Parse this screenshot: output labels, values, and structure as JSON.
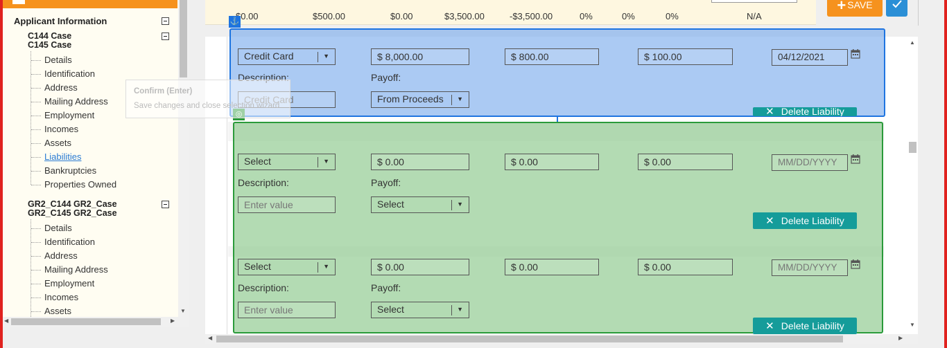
{
  "tree": {
    "section_title": "Applicant Information",
    "applicant1": {
      "line1": "C144 Case",
      "line2": "C145 Case",
      "items": [
        "Details",
        "Identification",
        "Address",
        "Mailing Address",
        "Employment",
        "Incomes",
        "Assets",
        "Liabilities",
        "Bankruptcies",
        "Properties Owned"
      ],
      "active": "Liabilities"
    },
    "applicant2": {
      "line1": "GR2_C144 GR2_Case",
      "line2": "GR2_C145 GR2_Case",
      "items": [
        "Details",
        "Identification",
        "Address",
        "Mailing Address",
        "Employment",
        "Incomes",
        "Assets"
      ]
    }
  },
  "tooltip": {
    "title": "Confirm (Enter)",
    "body": "Save changes and close selection wizard"
  },
  "summary": [
    "$0.00",
    "$500.00",
    "$0.00",
    "$3,500.00",
    "-$3,500.00",
    "0%",
    "0%",
    "0%",
    "N/A"
  ],
  "toolbar": {
    "save_label": "SAVE",
    "save_icon": "plus-icon",
    "confirm_icon": "check-icon"
  },
  "liabilities": [
    {
      "type": "Credit Card",
      "balance": "$ 8,000.00",
      "payment": "$ 800.00",
      "limit": "$ 100.00",
      "date": "04/12/2021",
      "description_label": "Description:",
      "description": "Credit Card",
      "payoff_label": "Payoff:",
      "payoff": "From Proceeds",
      "delete_label": "Delete Liability"
    },
    {
      "type": "Select",
      "balance": "$ 0.00",
      "payment": "$ 0.00",
      "limit": "$ 0.00",
      "date_placeholder": "MM/DD/YYYY",
      "description_label": "Description:",
      "description_placeholder": "Enter value",
      "payoff_label": "Payoff:",
      "payoff": "Select",
      "delete_label": "Delete Liability"
    },
    {
      "type": "Select",
      "balance": "$ 0.00",
      "payment": "$ 0.00",
      "limit": "$ 0.00",
      "date_placeholder": "MM/DD/YYYY",
      "description_label": "Description:",
      "description_placeholder": "Enter value",
      "payoff_label": "Payoff:",
      "payoff": "Select",
      "delete_label": "Delete Liability"
    }
  ],
  "colors": {
    "frame": "#e0221f",
    "accent_orange": "#f6921e",
    "confirm_blue": "#2b8fd6",
    "delete_teal": "#159c9a",
    "anchor_overlay": "#1e74e0",
    "target_overlay": "#2a9a3a"
  }
}
